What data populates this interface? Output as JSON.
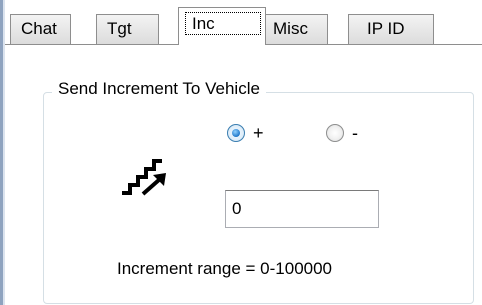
{
  "tabs": [
    {
      "label": "Chat",
      "selected": false
    },
    {
      "label": "Tgt",
      "selected": false
    },
    {
      "label": "Inc",
      "selected": true
    },
    {
      "label": "Misc",
      "selected": false
    },
    {
      "label": "IP ID",
      "selected": false
    }
  ],
  "group": {
    "title": "Send Increment To Vehicle"
  },
  "direction": {
    "plus_label": "+",
    "minus_label": "-",
    "selected": "+"
  },
  "increment_value": "0",
  "range_text": "Increment range = 0-100000",
  "icons": {
    "stairs": "stairs-up-arrow-icon"
  },
  "colors": {
    "tab_border": "#8e8e8e",
    "group_border": "#d5dfe5",
    "radio_selected": "#1f77c9"
  }
}
